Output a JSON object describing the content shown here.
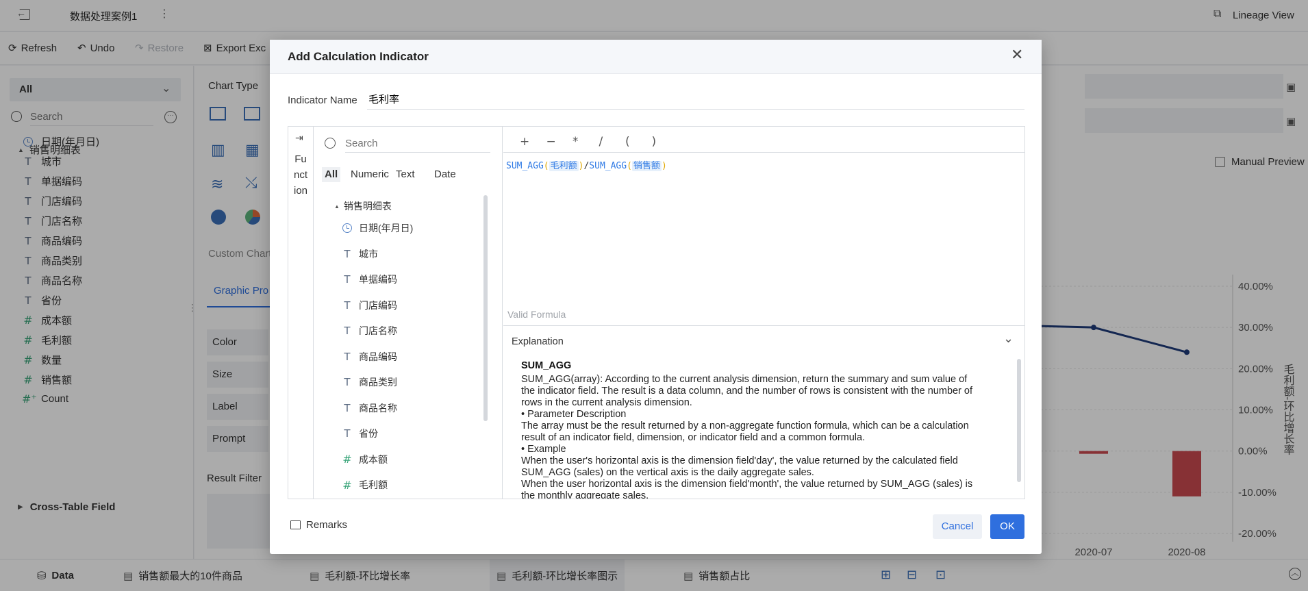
{
  "header": {
    "title": "数据处理案例1",
    "lineage_label": "Lineage View"
  },
  "toolbar": {
    "refresh": "Refresh",
    "undo": "Undo",
    "restore": "Restore",
    "export": "Export Exc"
  },
  "left": {
    "select_value": "All",
    "search_placeholder": "Search",
    "table_name": "销售明细表",
    "fields": [
      {
        "icon": "clock-icon",
        "label": "日期(年月日)"
      },
      {
        "icon": "text-icon",
        "label": "城市"
      },
      {
        "icon": "text-icon",
        "label": "单据编码"
      },
      {
        "icon": "text-icon",
        "label": "门店编码"
      },
      {
        "icon": "text-icon",
        "label": "门店名称"
      },
      {
        "icon": "text-icon",
        "label": "商品编码"
      },
      {
        "icon": "text-icon",
        "label": "商品类别"
      },
      {
        "icon": "text-icon",
        "label": "商品名称"
      },
      {
        "icon": "text-icon",
        "label": "省份"
      },
      {
        "icon": "hash-icon",
        "label": "成本额"
      },
      {
        "icon": "hash-icon",
        "label": "毛利额"
      },
      {
        "icon": "hash-icon",
        "label": "数量"
      },
      {
        "icon": "hash-icon",
        "label": "销售额"
      },
      {
        "icon": "hash-plus-icon",
        "label": "Count"
      }
    ],
    "cross_table": "Cross-Table Field"
  },
  "middle": {
    "chart_type": "Chart Type",
    "custom_chart": "Custom Chart",
    "graphic_tab": "Graphic Pro",
    "props": [
      "Color",
      "Size",
      "Label",
      "Prompt"
    ],
    "result_filter": "Result Filter",
    "manual_preview": "Manual Preview"
  },
  "chart": {
    "y_ticks": [
      "40.00%",
      "30.00%",
      "20.00%",
      "10.00%",
      "0.00%",
      "-10.00%",
      "-20.00%"
    ],
    "x_ticks": [
      "2020-07",
      "2020-08"
    ],
    "y_axis_title": "毛利额-环比增长率",
    "line_points": [
      {
        "x": "2020-07",
        "y": 0.3
      },
      {
        "x": "2020-08",
        "y": 0.24
      }
    ],
    "bar_values": [
      {
        "x": "2020-07",
        "y": -0.004
      },
      {
        "x": "2020-08",
        "y": -0.11
      }
    ]
  },
  "bottom": {
    "data_tab": "Data",
    "tabs": [
      "销售额最大的10件商品",
      "毛利额-环比增长率",
      "毛利额-环比增长率图示",
      "销售额占比"
    ]
  },
  "dialog": {
    "title": "Add Calculation Indicator",
    "name_label": "Indicator Name",
    "name_value": "毛利率",
    "function_label": "Function",
    "search_placeholder": "Search",
    "filter_tabs": [
      "All",
      "Numeric",
      "Text",
      "Date"
    ],
    "table_name": "销售明细表",
    "fields": [
      {
        "icon": "clock-icon",
        "label": "日期(年月日)"
      },
      {
        "icon": "text-icon",
        "label": "城市"
      },
      {
        "icon": "text-icon",
        "label": "单据编码"
      },
      {
        "icon": "text-icon",
        "label": "门店编码"
      },
      {
        "icon": "text-icon",
        "label": "门店名称"
      },
      {
        "icon": "text-icon",
        "label": "商品编码"
      },
      {
        "icon": "text-icon",
        "label": "商品类别"
      },
      {
        "icon": "text-icon",
        "label": "商品名称"
      },
      {
        "icon": "text-icon",
        "label": "省份"
      },
      {
        "icon": "hash-icon",
        "label": "成本额"
      },
      {
        "icon": "hash-icon",
        "label": "毛利额"
      }
    ],
    "operators": [
      "+",
      "−",
      "*",
      "/",
      "(",
      ")"
    ],
    "formula": {
      "f1": "SUM_AGG",
      "f2": "SUM_AGG",
      "field1": "毛利额",
      "field2": "销售额",
      "slash": "/",
      "open": "(",
      "close": ")"
    },
    "valid_text": "Valid Formula",
    "explanation_title": "Explanation",
    "func_name": "SUM_AGG",
    "explanation_lines": [
      "SUM_AGG(array): According to the current analysis dimension, return the summary and sum value of",
      "the indicator field. The result is a data column, and the number of rows is consistent with the number of",
      "rows in the current analysis dimension.",
      "• Parameter Description",
      "The array must be the result returned by a non-aggregate function formula, which can be a calculation",
      "result of an indicator field, dimension, or indicator field and a common formula.",
      "• Example",
      "When the user's horizontal axis is the dimension field'day', the value returned by the calculated field",
      "SUM_AGG (sales) on the vertical axis is the daily aggregate sales.",
      "When the user horizontal axis is the dimension field'month', the value returned by SUM_AGG (sales) is",
      "the monthly aggregate sales."
    ],
    "remarks": "Remarks",
    "cancel": "Cancel",
    "ok": "OK"
  }
}
